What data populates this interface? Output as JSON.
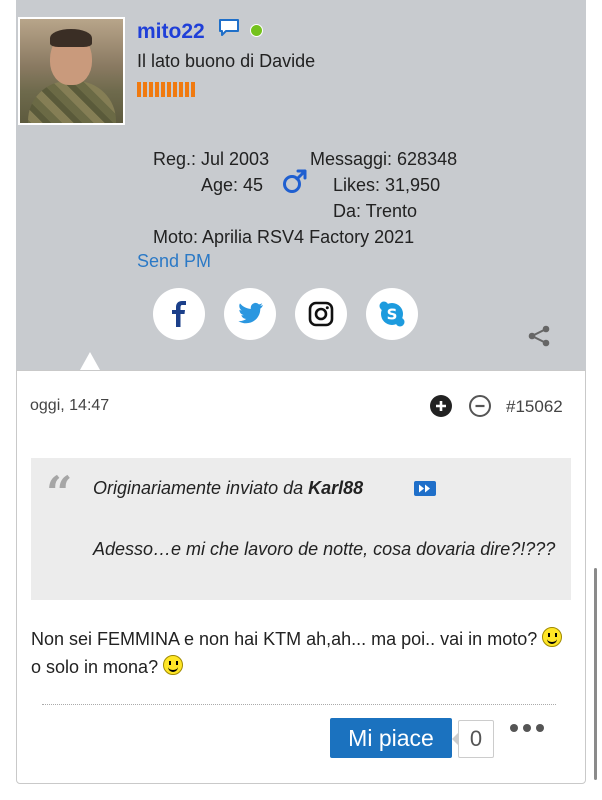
{
  "profile": {
    "username": "mito22",
    "usertitle": "Il lato buono di Davide",
    "reg": "Reg.: Jul 2003",
    "messages": "Messaggi: 628348",
    "age": "Age: 45",
    "gender_symbol": "♂",
    "likes": "Likes: 31,950",
    "location": "Da: Trento",
    "moto": "Moto: Aprilia RSV4 Factory 2021",
    "send_pm": "Send PM",
    "reputation_bars": 10,
    "social_icons": [
      "facebook-icon",
      "twitter-icon",
      "instagram-icon",
      "skype-icon"
    ],
    "colors": {
      "username": "#1f3fd8",
      "online": "#74c21c",
      "reputation": "#f07a10",
      "link": "#2b79c6"
    }
  },
  "post": {
    "date": "oggi, 14:47",
    "number": "#15062",
    "quote": {
      "prefix": "Originariamente inviato da",
      "author": "Karl88",
      "text": "Adesso…e mi che lavoro de notte, cosa dovaria dire?!???"
    },
    "message_part1": "Non sei FEMMINA e non hai KTM ah,ah... ma poi.. vai in moto?",
    "message_part2": "o solo in mona?",
    "like_label": "Mi piace",
    "like_count": "0"
  }
}
